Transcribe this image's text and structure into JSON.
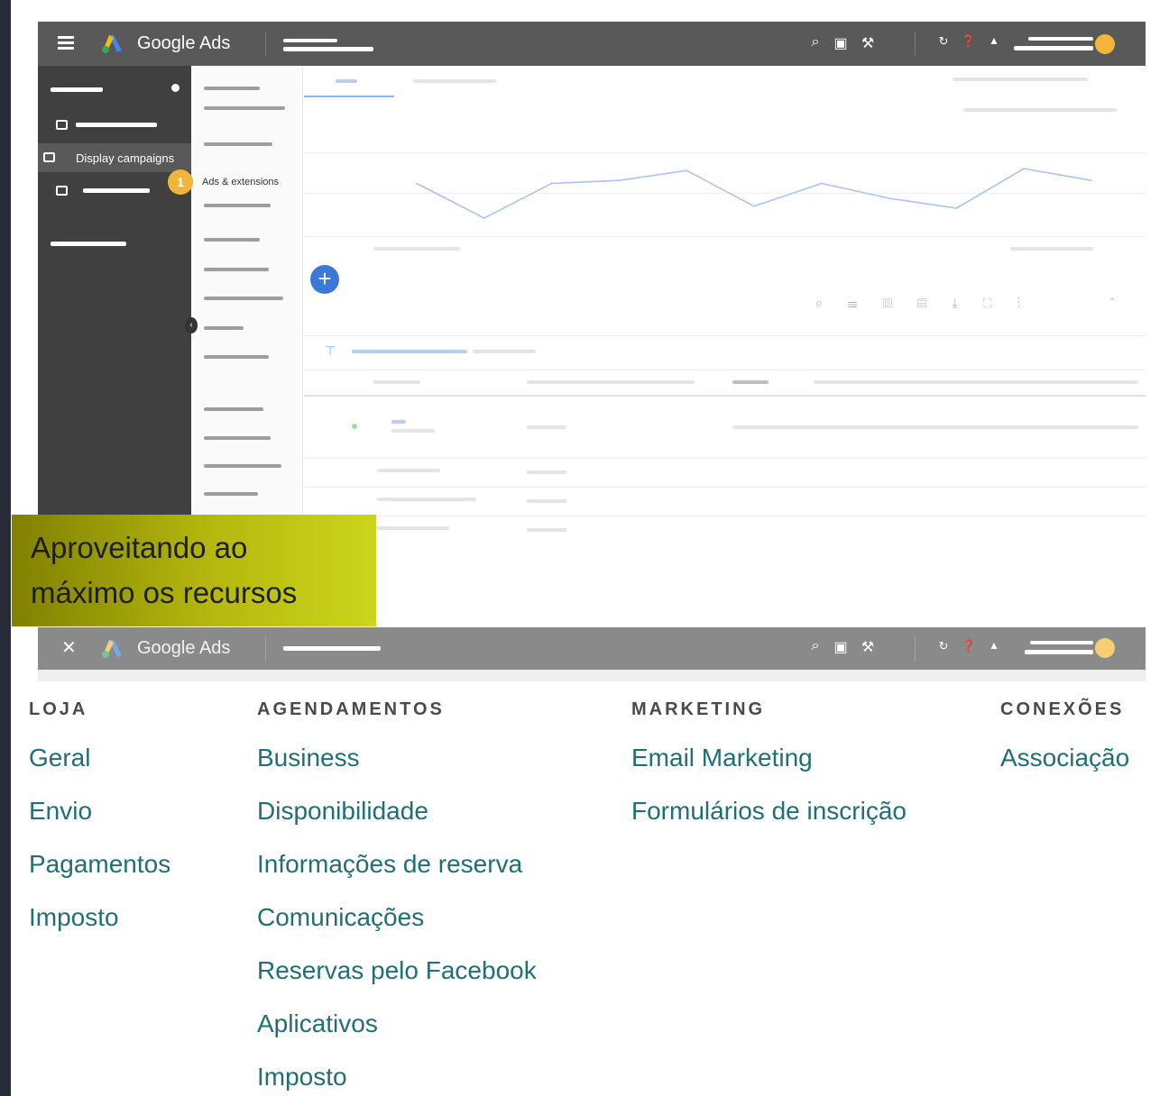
{
  "app": {
    "brand": "Google Ads"
  },
  "sidebar": {
    "selected_item": "Display campaigns",
    "sub_item": "Ads & extensions",
    "step_badge": "1"
  },
  "caption": {
    "line1": "Aproveitando ao",
    "line2": "máximo os recursos"
  },
  "menu": {
    "columns": [
      {
        "heading": "LOJA",
        "items": [
          "Geral",
          "Envio",
          "Pagamentos",
          "Imposto"
        ]
      },
      {
        "heading": "AGENDAMENTOS",
        "items": [
          "Business",
          "Disponibilidade",
          "Informações de reserva",
          "Comunicações",
          "Reservas pelo Facebook",
          "Aplicativos",
          "Imposto"
        ]
      },
      {
        "heading": "MARKETING",
        "items": [
          "Email Marketing",
          "Formulários de inscrição"
        ]
      },
      {
        "heading": "CONEXÕES",
        "items": [
          "Associação"
        ]
      }
    ]
  },
  "chart_data": {
    "type": "line",
    "x": [
      1,
      2,
      3,
      4,
      5,
      6,
      7,
      8,
      9,
      10,
      11
    ],
    "series": [
      {
        "values": [
          55,
          20,
          55,
          58,
          68,
          32,
          55,
          40,
          30,
          70,
          58
        ]
      }
    ],
    "ylim": [
      0,
      100
    ],
    "grid": true
  },
  "colors": {
    "accent": "#3c78d8",
    "badge": "#f2b53a",
    "link": "#1f6f74",
    "topbar": "#595959"
  },
  "icons": {
    "menu": "hamburger-icon",
    "close": "close-icon",
    "add": "plus-icon",
    "collapse": "chevron-left-icon"
  }
}
